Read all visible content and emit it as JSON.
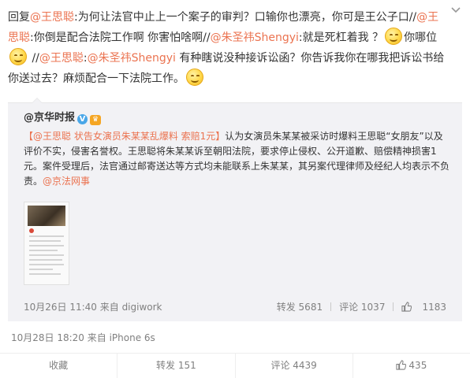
{
  "post": {
    "segments": [
      {
        "text": "回复",
        "mention": false
      },
      {
        "text": "@王思聪",
        "mention": true
      },
      {
        "text": ":为何让法官中止上一个案子的审判？口输你也漂亮，你可是王公子口//",
        "mention": false
      },
      {
        "text": "@王思聪",
        "mention": true
      },
      {
        "text": ":你倒是配合法院工作啊 你害怕啥啊//",
        "mention": false
      },
      {
        "text": "@朱圣祎Shengyi",
        "mention": true
      },
      {
        "text": ":就是死杠着我 ？",
        "mention": false
      }
    ],
    "segments_b": [
      {
        "text": "你哪位",
        "mention": false
      }
    ],
    "segments_c": [
      {
        "text": " //",
        "mention": false
      },
      {
        "text": "@王思聪",
        "mention": true
      },
      {
        "text": ":",
        "mention": false
      },
      {
        "text": "@朱圣祎Shengyi",
        "mention": true
      },
      {
        "text": " 有种瞎说没种接诉讼函？你告诉我你在哪我把诉讼书给你送过去？麻烦配合一下法院工作。",
        "mention": false
      }
    ],
    "emoji_name": "smile-emoji",
    "meta": "10月28日 18:20 来自 iPhone 6s"
  },
  "original": {
    "author": "@京华时报",
    "verified_badge": "V",
    "member_badge": "♛",
    "text_link": "【@王思聪 状告女演员朱某某乱爆料 索赔1元】",
    "text_body": "认为女演员朱某某被采访时爆料王思聪“女朋友”以及评价不实，侵害名誉权。王思聪将朱某某诉至朝阳法院，要求停止侵权、公开道歉、赔偿精神损害1元。案件受理后，法官通过邮寄送达等方式均未能联系上朱某某，其另案代理律师及经纪人均表示不负责。",
    "text_tail_link": "@京法网事",
    "meta": "10月26日 11:40 来自 digiwork",
    "repost_label": "转发 5681",
    "comment_label": "评论 1037",
    "like_count": "1183"
  },
  "actions": {
    "favorite": "收藏",
    "repost": "转发 151",
    "comment": "评论 4439",
    "like": "435"
  },
  "colors": {
    "mention": "#eb7350",
    "meta_text": "#808080",
    "repost_bg": "#f2f2f5"
  },
  "icons": [
    "chevron-down-icon",
    "smile-emoji",
    "verified-icon",
    "member-icon",
    "like-icon"
  ]
}
